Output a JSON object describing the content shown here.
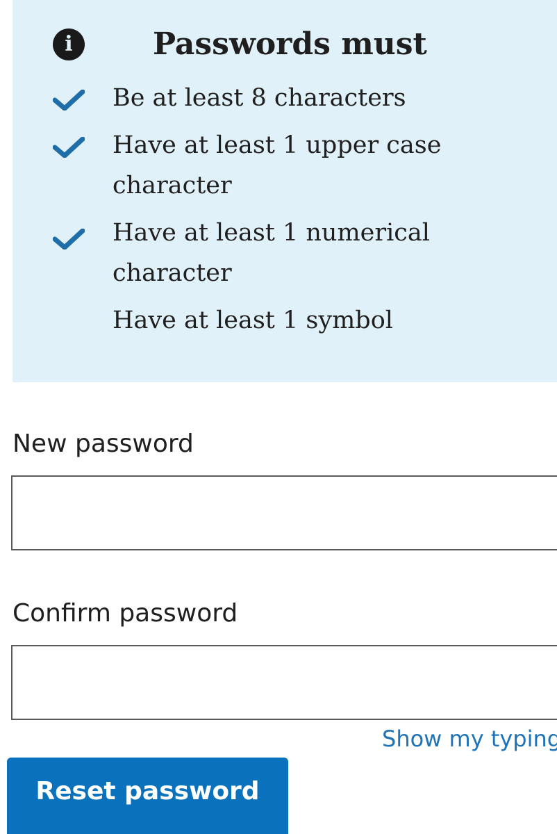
{
  "requirements_panel": {
    "icon": "info-icon",
    "icon_glyph": "i",
    "title": "Passwords must",
    "items": [
      {
        "text": "Be at least 8 characters",
        "met": true
      },
      {
        "text": "Have at least 1 upper case character",
        "met": true
      },
      {
        "text": "Have at least 1 numerical character",
        "met": true
      },
      {
        "text": "Have at least 1 symbol",
        "met": false
      }
    ],
    "background_color": "#e1f1f9",
    "check_color": "#1f6ea8"
  },
  "form": {
    "new_password_label": "New password",
    "new_password_value": "",
    "confirm_password_label": "Confirm password",
    "confirm_password_value": "",
    "show_typing_label": "Show my typing",
    "submit_label": "Reset password",
    "link_color": "#1f74b7",
    "button_color": "#0a72bd"
  }
}
